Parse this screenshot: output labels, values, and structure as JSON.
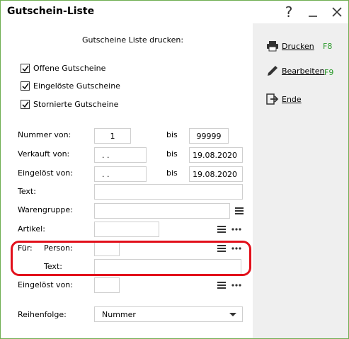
{
  "window": {
    "title": "Gutschein-Liste",
    "help_glyph": "?"
  },
  "form": {
    "heading": "Gutscheine Liste drucken:",
    "checkboxes": [
      {
        "label": "Offene Gutscheine",
        "checked": true
      },
      {
        "label": "Eingelöste Gutscheine",
        "checked": true
      },
      {
        "label": "Stornierte Gutscheine",
        "checked": true
      }
    ],
    "nummer_von": {
      "label": "Nummer von:",
      "value": "1",
      "bis_label": "bis",
      "bis_value": "99999"
    },
    "verkauft_von": {
      "label": "Verkauft von:",
      "value": ". .",
      "bis_label": "bis",
      "bis_value": "19.08.2020"
    },
    "eingeloest_von": {
      "label": "Eingelöst von:",
      "value": ". .",
      "bis_label": "bis",
      "bis_value": "19.08.2020"
    },
    "text": {
      "label": "Text:",
      "value": ""
    },
    "warengruppe": {
      "label": "Warengruppe:",
      "value": ""
    },
    "artikel": {
      "label": "Artikel:",
      "value": ""
    },
    "fuer": {
      "label": "Für:",
      "person_label": "Person:",
      "person_value": "",
      "text_label": "Text:",
      "text_value": ""
    },
    "eingeloest_von2": {
      "label": "Eingelöst von:",
      "value": ""
    },
    "reihenfolge": {
      "label": "Reihenfolge:",
      "value": "Nummer"
    }
  },
  "sidebar": {
    "drucken": {
      "label": "Drucken",
      "key": "F8"
    },
    "bearbeiten": {
      "label": "Bearbeiten",
      "key": "F9"
    },
    "ende": {
      "label": "Ende"
    }
  },
  "colors": {
    "window_border": "#6fae51",
    "sidebar_bg": "#efefef",
    "highlight": "#e2101b",
    "shortcut_green": "#2b9a2b"
  },
  "icons": {
    "list": "list-icon",
    "more": "more-icon",
    "printer": "printer-icon",
    "pencil": "pencil-icon",
    "exit": "exit-icon"
  }
}
